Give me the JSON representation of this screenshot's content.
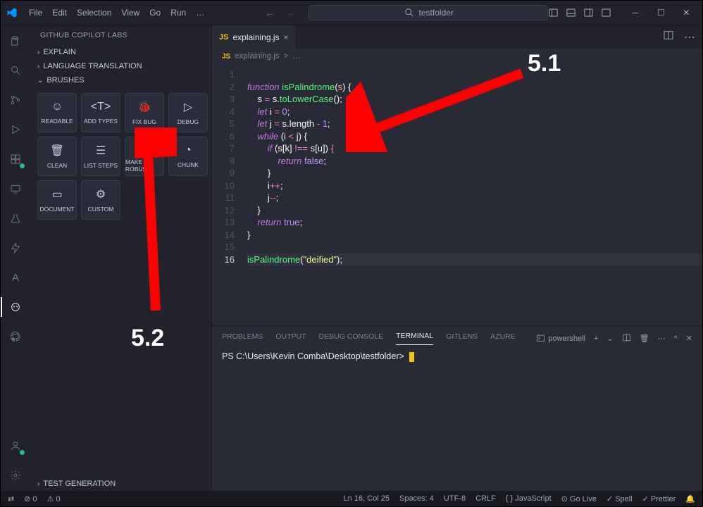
{
  "menu": [
    "File",
    "Edit",
    "Selection",
    "View",
    "Go",
    "Run",
    "…"
  ],
  "search_placeholder": "testfolder",
  "activity_bar": {
    "top": [
      "files-icon",
      "search-icon",
      "source-control-icon",
      "run-debug-icon",
      "extensions-icon",
      "remote-icon",
      "test-icon",
      "bolt-icon",
      "azure-a-icon",
      "copilot-icon",
      "github-icon"
    ],
    "bottom": [
      "account-icon",
      "settings-icon"
    ]
  },
  "sidebar": {
    "title": "GITHUB COPILOT LABS",
    "sections": [
      {
        "label": "EXPLAIN",
        "expanded": false
      },
      {
        "label": "LANGUAGE TRANSLATION",
        "expanded": false
      },
      {
        "label": "BRUSHES",
        "expanded": true
      },
      {
        "label": "TEST GENERATION",
        "expanded": false
      }
    ],
    "brushes": [
      {
        "icon": "☺",
        "label": "READABLE"
      },
      {
        "icon": "<T>",
        "label": "ADD TYPES"
      },
      {
        "icon": "🐞",
        "label": "FIX BUG"
      },
      {
        "icon": "▷",
        "label": "DEBUG"
      },
      {
        "icon": "🗑",
        "label": "CLEAN"
      },
      {
        "icon": "☰",
        "label": "LIST STEPS"
      },
      {
        "icon": "🛡",
        "label": "MAKE ROBUST"
      },
      {
        "icon": "◔",
        "label": "CHUNK"
      },
      {
        "icon": "▭",
        "label": "DOCUMENT"
      },
      {
        "icon": "⚙",
        "label": "CUSTOM"
      }
    ]
  },
  "tab": {
    "filename": "explaining.js",
    "close": "×"
  },
  "breadcrumb": {
    "file": "explaining.js",
    "sep": ">",
    "more": "…"
  },
  "code_lines": [
    "1",
    "2",
    "3",
    "4",
    "5",
    "6",
    "7",
    "8",
    "9",
    "10",
    "11",
    "12",
    "13",
    "14",
    "15",
    "16"
  ],
  "panel_tabs": [
    "PROBLEMS",
    "OUTPUT",
    "DEBUG CONSOLE",
    "TERMINAL",
    "GITLENS",
    "AZURE"
  ],
  "panel_active": "TERMINAL",
  "terminal": {
    "shell_label": "powershell",
    "prompt": "PS C:\\Users\\Kevin Comba\\Desktop\\testfolder>"
  },
  "status": {
    "left": [
      "⊘ 0",
      "⚠ 0"
    ],
    "right": [
      "Ln 16, Col 25",
      "Spaces: 4",
      "UTF-8",
      "CRLF",
      "{ } JavaScript",
      "⊙ Go Live",
      "✓ Spell",
      "✓ Prettier",
      "🔔"
    ]
  },
  "annotations": {
    "a1": "5.1",
    "a2": "5.2"
  }
}
